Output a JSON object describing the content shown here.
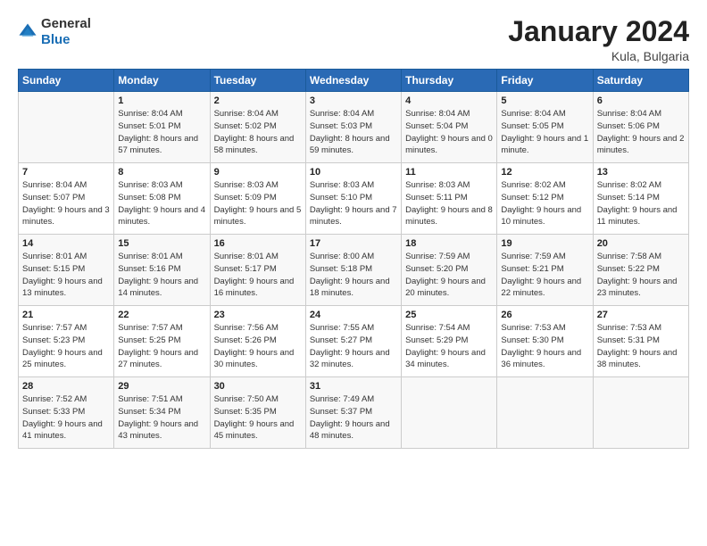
{
  "logo": {
    "general": "General",
    "blue": "Blue"
  },
  "title": "January 2024",
  "subtitle": "Kula, Bulgaria",
  "header": {
    "days": [
      "Sunday",
      "Monday",
      "Tuesday",
      "Wednesday",
      "Thursday",
      "Friday",
      "Saturday"
    ]
  },
  "weeks": [
    [
      {
        "num": "",
        "info": ""
      },
      {
        "num": "1",
        "info": "Sunrise: 8:04 AM\nSunset: 5:01 PM\nDaylight: 8 hours\nand 57 minutes."
      },
      {
        "num": "2",
        "info": "Sunrise: 8:04 AM\nSunset: 5:02 PM\nDaylight: 8 hours\nand 58 minutes."
      },
      {
        "num": "3",
        "info": "Sunrise: 8:04 AM\nSunset: 5:03 PM\nDaylight: 8 hours\nand 59 minutes."
      },
      {
        "num": "4",
        "info": "Sunrise: 8:04 AM\nSunset: 5:04 PM\nDaylight: 9 hours\nand 0 minutes."
      },
      {
        "num": "5",
        "info": "Sunrise: 8:04 AM\nSunset: 5:05 PM\nDaylight: 9 hours\nand 1 minute."
      },
      {
        "num": "6",
        "info": "Sunrise: 8:04 AM\nSunset: 5:06 PM\nDaylight: 9 hours\nand 2 minutes."
      }
    ],
    [
      {
        "num": "7",
        "info": "Sunrise: 8:04 AM\nSunset: 5:07 PM\nDaylight: 9 hours\nand 3 minutes."
      },
      {
        "num": "8",
        "info": "Sunrise: 8:03 AM\nSunset: 5:08 PM\nDaylight: 9 hours\nand 4 minutes."
      },
      {
        "num": "9",
        "info": "Sunrise: 8:03 AM\nSunset: 5:09 PM\nDaylight: 9 hours\nand 5 minutes."
      },
      {
        "num": "10",
        "info": "Sunrise: 8:03 AM\nSunset: 5:10 PM\nDaylight: 9 hours\nand 7 minutes."
      },
      {
        "num": "11",
        "info": "Sunrise: 8:03 AM\nSunset: 5:11 PM\nDaylight: 9 hours\nand 8 minutes."
      },
      {
        "num": "12",
        "info": "Sunrise: 8:02 AM\nSunset: 5:12 PM\nDaylight: 9 hours\nand 10 minutes."
      },
      {
        "num": "13",
        "info": "Sunrise: 8:02 AM\nSunset: 5:14 PM\nDaylight: 9 hours\nand 11 minutes."
      }
    ],
    [
      {
        "num": "14",
        "info": "Sunrise: 8:01 AM\nSunset: 5:15 PM\nDaylight: 9 hours\nand 13 minutes."
      },
      {
        "num": "15",
        "info": "Sunrise: 8:01 AM\nSunset: 5:16 PM\nDaylight: 9 hours\nand 14 minutes."
      },
      {
        "num": "16",
        "info": "Sunrise: 8:01 AM\nSunset: 5:17 PM\nDaylight: 9 hours\nand 16 minutes."
      },
      {
        "num": "17",
        "info": "Sunrise: 8:00 AM\nSunset: 5:18 PM\nDaylight: 9 hours\nand 18 minutes."
      },
      {
        "num": "18",
        "info": "Sunrise: 7:59 AM\nSunset: 5:20 PM\nDaylight: 9 hours\nand 20 minutes."
      },
      {
        "num": "19",
        "info": "Sunrise: 7:59 AM\nSunset: 5:21 PM\nDaylight: 9 hours\nand 22 minutes."
      },
      {
        "num": "20",
        "info": "Sunrise: 7:58 AM\nSunset: 5:22 PM\nDaylight: 9 hours\nand 23 minutes."
      }
    ],
    [
      {
        "num": "21",
        "info": "Sunrise: 7:57 AM\nSunset: 5:23 PM\nDaylight: 9 hours\nand 25 minutes."
      },
      {
        "num": "22",
        "info": "Sunrise: 7:57 AM\nSunset: 5:25 PM\nDaylight: 9 hours\nand 27 minutes."
      },
      {
        "num": "23",
        "info": "Sunrise: 7:56 AM\nSunset: 5:26 PM\nDaylight: 9 hours\nand 30 minutes."
      },
      {
        "num": "24",
        "info": "Sunrise: 7:55 AM\nSunset: 5:27 PM\nDaylight: 9 hours\nand 32 minutes."
      },
      {
        "num": "25",
        "info": "Sunrise: 7:54 AM\nSunset: 5:29 PM\nDaylight: 9 hours\nand 34 minutes."
      },
      {
        "num": "26",
        "info": "Sunrise: 7:53 AM\nSunset: 5:30 PM\nDaylight: 9 hours\nand 36 minutes."
      },
      {
        "num": "27",
        "info": "Sunrise: 7:53 AM\nSunset: 5:31 PM\nDaylight: 9 hours\nand 38 minutes."
      }
    ],
    [
      {
        "num": "28",
        "info": "Sunrise: 7:52 AM\nSunset: 5:33 PM\nDaylight: 9 hours\nand 41 minutes."
      },
      {
        "num": "29",
        "info": "Sunrise: 7:51 AM\nSunset: 5:34 PM\nDaylight: 9 hours\nand 43 minutes."
      },
      {
        "num": "30",
        "info": "Sunrise: 7:50 AM\nSunset: 5:35 PM\nDaylight: 9 hours\nand 45 minutes."
      },
      {
        "num": "31",
        "info": "Sunrise: 7:49 AM\nSunset: 5:37 PM\nDaylight: 9 hours\nand 48 minutes."
      },
      {
        "num": "",
        "info": ""
      },
      {
        "num": "",
        "info": ""
      },
      {
        "num": "",
        "info": ""
      }
    ]
  ]
}
